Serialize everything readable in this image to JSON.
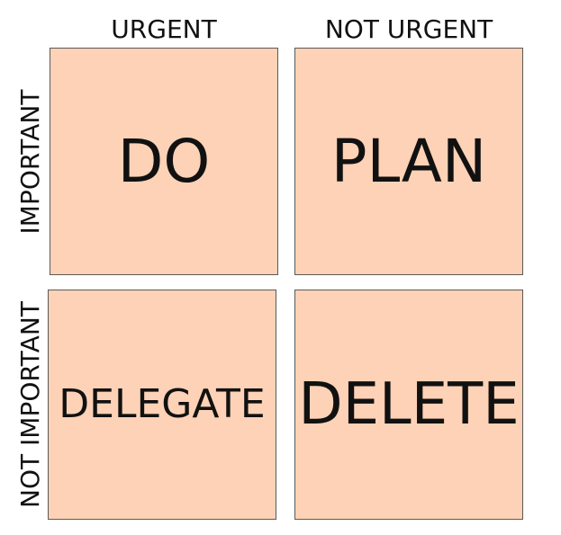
{
  "columns": {
    "urgent": "URGENT",
    "not_urgent": "NOT URGENT"
  },
  "rows": {
    "important": "IMPORTANT",
    "not_important": "NOT IMPORTANT"
  },
  "quadrants": {
    "do": "DO",
    "plan": "PLAN",
    "delegate": "DELEGATE",
    "delete": "DELETE"
  },
  "colors": {
    "quadrant_fill": "#fdd2b6",
    "border": "#5a5a5a",
    "text": "#111111"
  }
}
